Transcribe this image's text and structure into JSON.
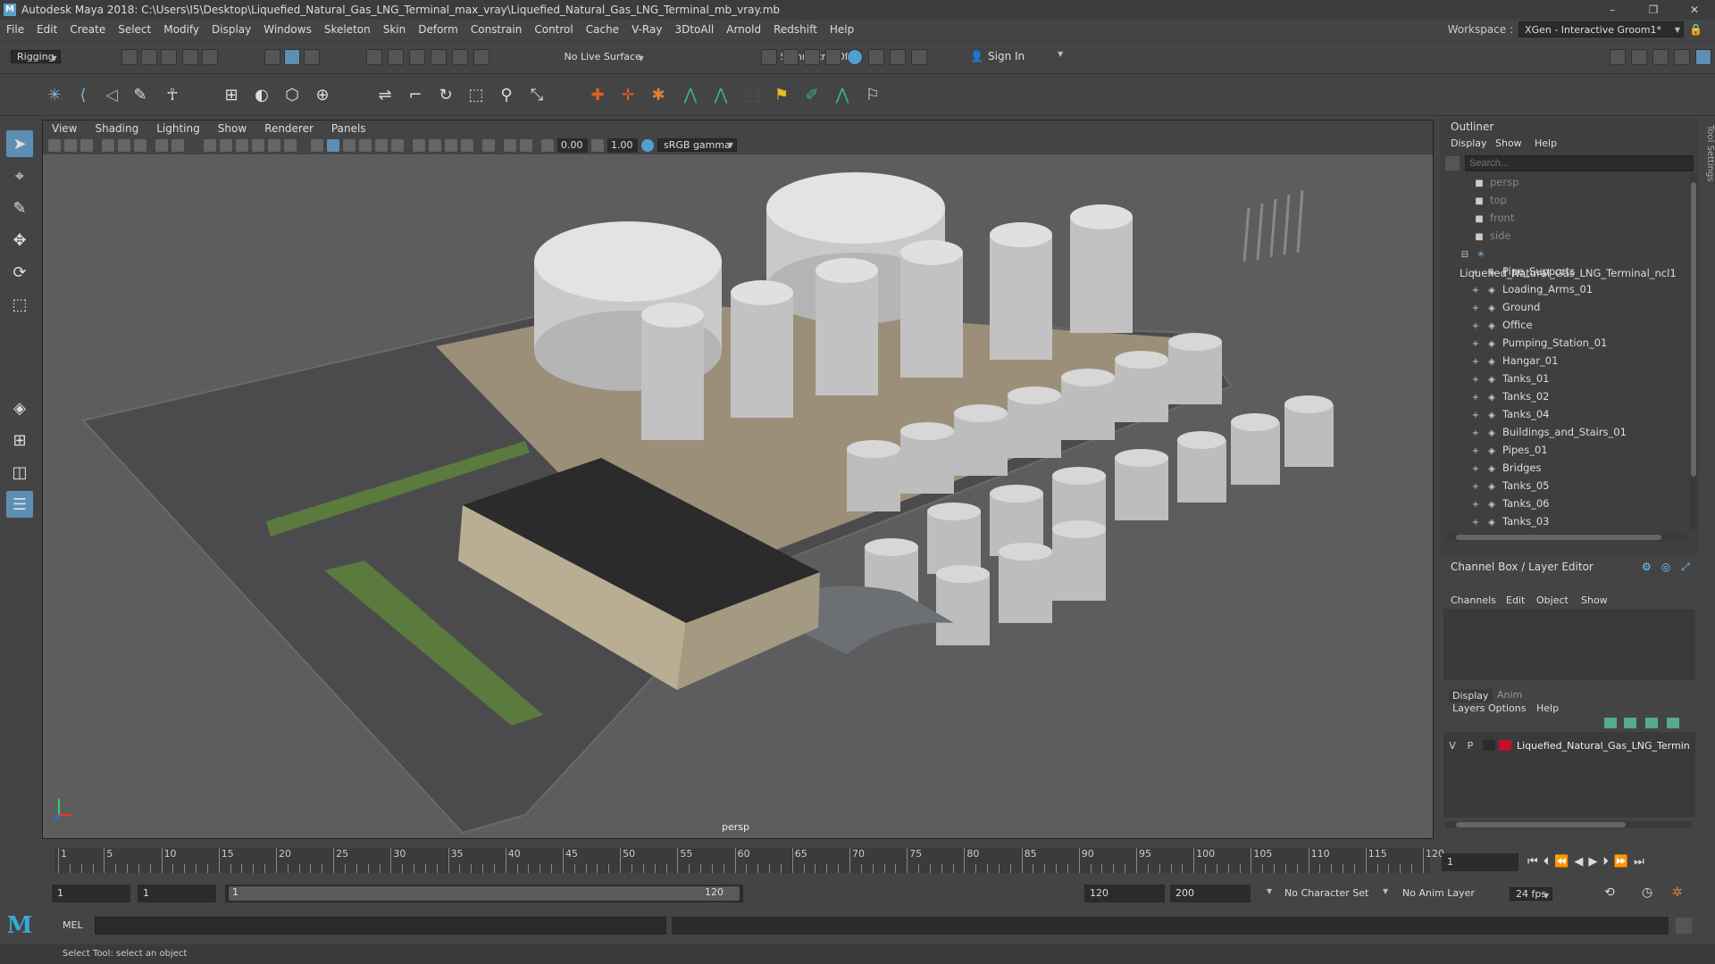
{
  "window": {
    "title": "Autodesk Maya 2018: C:\\Users\\I5\\Desktop\\Liquefied_Natural_Gas_LNG_Terminal_max_vray\\Liquefied_Natural_Gas_LNG_Terminal_mb_vray.mb",
    "minimize": "–",
    "maximize": "❐",
    "close": "✕"
  },
  "menubar": {
    "items": [
      "File",
      "Edit",
      "Create",
      "Select",
      "Modify",
      "Display",
      "Windows",
      "Skeleton",
      "Skin",
      "Deform",
      "Constrain",
      "Control",
      "Cache",
      "V-Ray",
      "3DtoAll",
      "Arnold",
      "Redshift",
      "Help"
    ],
    "workspace_label": "Workspace :",
    "workspace_value": "XGen - Interactive Groom1*"
  },
  "statusline": {
    "menuset": "Rigging",
    "live_surface": "No Live Surface",
    "symmetry": "Symmetry: Off",
    "sign_in": "Sign In"
  },
  "viewport": {
    "menus": [
      "View",
      "Shading",
      "Lighting",
      "Show",
      "Renderer",
      "Panels"
    ],
    "exposure": "0.00",
    "gamma": "1.00",
    "colorspace": "sRGB gamma",
    "camera_label": "persp"
  },
  "outliner": {
    "title": "Outliner",
    "menus": [
      "Display",
      "Show",
      "Help"
    ],
    "search_placeholder": "Search...",
    "cameras": [
      "persp",
      "top",
      "front",
      "side"
    ],
    "root": "Liquefied_Natural_Gas_LNG_Terminal_ncl1",
    "children": [
      "Pipe_Supports",
      "Loading_Arms_01",
      "Ground",
      "Office",
      "Pumping_Station_01",
      "Hangar_01",
      "Tanks_01",
      "Tanks_02",
      "Tanks_04",
      "Buildings_and_Stairs_01",
      "Pipes_01",
      "Bridges",
      "Tanks_05",
      "Tanks_06",
      "Tanks_03"
    ]
  },
  "channelbox": {
    "title": "Channel Box / Layer Editor",
    "menus": [
      "Channels",
      "Edit",
      "Object",
      "Show"
    ],
    "tabs": [
      "Display",
      "Anim"
    ],
    "layer_menus": [
      "Layers",
      "Options",
      "Help"
    ],
    "layer": {
      "v": "V",
      "p": "P",
      "name": "Liquefied_Natural_Gas_LNG_Termin",
      "color": "#c0102a"
    }
  },
  "timeline": {
    "labels": [
      "1",
      "5",
      "10",
      "15",
      "20",
      "25",
      "30",
      "35",
      "40",
      "45",
      "50",
      "55",
      "60",
      "65",
      "70",
      "75",
      "80",
      "85",
      "90",
      "95",
      "100",
      "105",
      "110",
      "115",
      "120"
    ],
    "current_frame": "1"
  },
  "range": {
    "start": "1",
    "playback_start": "1",
    "slider_start": "1",
    "slider_end": "120",
    "playback_end": "120",
    "end": "200",
    "character_set": "No Character Set",
    "anim_layer": "No Anim Layer",
    "fps": "24 fps"
  },
  "mel": {
    "label": "MEL"
  },
  "helpline": {
    "text": "Select Tool: select an object"
  },
  "side_tab": "Tool Settings"
}
